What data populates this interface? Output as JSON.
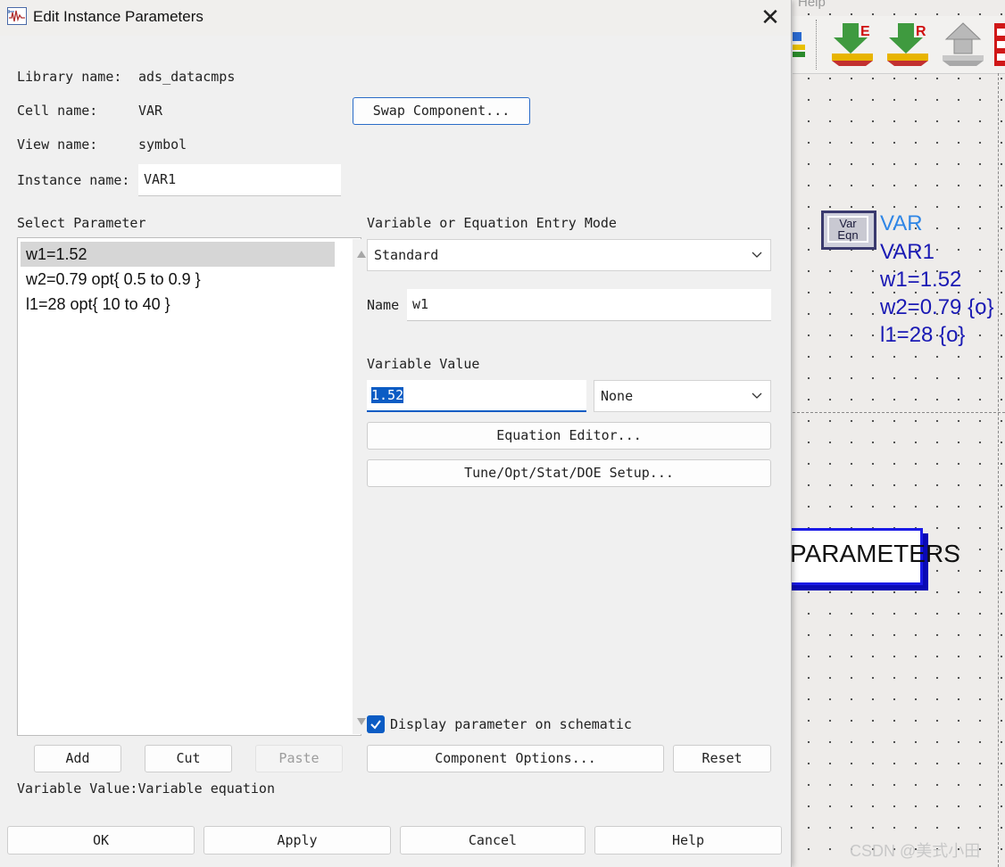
{
  "dialog": {
    "title": "Edit Instance Parameters",
    "library_label": "Library name:",
    "library_value": "ads_datacmps",
    "cell_label": "Cell name:",
    "cell_value": "VAR",
    "view_label": "View name:",
    "view_value": "symbol",
    "instance_label": "Instance name:",
    "instance_value": "VAR1",
    "swap_button": "Swap Component...",
    "select_parameter_label": "Select Parameter",
    "parameters": [
      {
        "text": "w1=1.52",
        "selected": true
      },
      {
        "text": "w2=0.79 opt{ 0.5 to 0.9 }",
        "selected": false
      },
      {
        "text": "l1=28 opt{ 10 to 40 }",
        "selected": false
      }
    ],
    "add_button": "Add",
    "cut_button": "Cut",
    "paste_button": "Paste",
    "entry_mode_label": "Variable or Equation Entry Mode",
    "entry_mode_value": "Standard",
    "name_label": "Name",
    "name_value": "w1",
    "variable_value_label": "Variable Value",
    "variable_value": "1.52",
    "unit_value": "None",
    "equation_editor_button": "Equation Editor...",
    "tune_button": "Tune/Opt/Stat/DOE Setup...",
    "display_checkbox_label": "Display parameter on schematic",
    "display_checked": true,
    "component_options_button": "Component Options...",
    "reset_button": "Reset",
    "status_text": "Variable Value:Variable equation",
    "ok_button": "OK",
    "apply_button": "Apply",
    "cancel_button": "Cancel",
    "help_button": "Help"
  },
  "schematic": {
    "menu_text": "Help",
    "var_block_line1": "Var",
    "var_block_line2": "Eqn",
    "lines": [
      "VAR",
      "VAR1",
      "w1=1.52",
      "w2=0.79 {o}",
      "l1=28 {o}"
    ],
    "params_box_text": "PARAMETERS",
    "toolbar_icons": [
      "push-down-e-icon",
      "push-down-r-icon",
      "pop-up-icon",
      "red-grid-icon"
    ],
    "colors": {
      "var_title": "#2f86e6",
      "var_text": "#1a1ab4",
      "params_border": "#1a1ae6"
    }
  },
  "watermark": "CSDN @美式小田"
}
